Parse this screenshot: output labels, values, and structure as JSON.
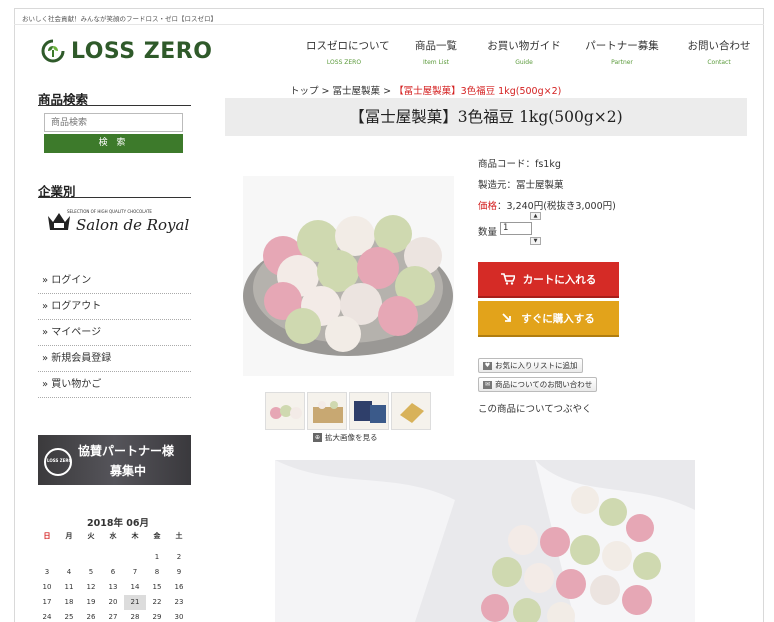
{
  "header": {
    "tagline": "おいしく社会貢献！みんなが笑顔のフードロス・ゼロ【ロスゼロ】",
    "logo_text": "LOSS ZERO",
    "nav": [
      {
        "ja": "ロスゼロについて",
        "en": "LOSS ZERO"
      },
      {
        "ja": "商品一覧",
        "en": "Item List"
      },
      {
        "ja": "お買い物ガイド",
        "en": "Guide"
      },
      {
        "ja": "パートナー募集",
        "en": "Partner"
      },
      {
        "ja": "お問い合わせ",
        "en": "Contact"
      }
    ]
  },
  "sidebar": {
    "search_title": "商品検索",
    "search_placeholder": "商品検索",
    "search_button": "検 索",
    "company_title": "企業別",
    "salon_sub": "SELECTION OF HIGH QUALITY CHOCOLATE",
    "salon_name": "Salon de Royal",
    "menu": [
      "» ログイン",
      "» ログアウト",
      "» マイページ",
      "» 新規会員登録",
      "» 買い物かご"
    ],
    "banner_line1": "協賛パートナー様",
    "banner_line2": "募集中",
    "banner_logo": "LOSS ZERO",
    "calendar": {
      "title": "2018年 06月",
      "weekdays": [
        "日",
        "月",
        "火",
        "水",
        "木",
        "金",
        "土"
      ],
      "rows": [
        [
          "",
          "",
          "",
          "",
          "",
          "1",
          "2"
        ],
        [
          "3",
          "4",
          "5",
          "6",
          "7",
          "8",
          "9"
        ],
        [
          "10",
          "11",
          "12",
          "13",
          "14",
          "15",
          "16"
        ],
        [
          "17",
          "18",
          "19",
          "20",
          "21",
          "22",
          "23"
        ],
        [
          "24",
          "25",
          "26",
          "27",
          "28",
          "29",
          "30"
        ]
      ],
      "today": "21"
    }
  },
  "product": {
    "breadcrumb_home": "トップ",
    "breadcrumb_sep": ">",
    "breadcrumb_cat": "冨士屋製菓",
    "breadcrumb_current": "【冨士屋製菓】3色福豆 1kg(500g×2)",
    "title": "【冨士屋製菓】3色福豆 1kg(500g×2)",
    "code": "商品コード：fs1kg",
    "maker": "製造元：冨士屋製菓",
    "price_label": "価格",
    "price_value": "：3,240円(税抜き3,000円)",
    "qty_label": "数量",
    "qty_value": "1",
    "cart_button": "カートに入れる",
    "buy_button": "すぐに購入する",
    "favorite_button": "お気に入りリストに追加",
    "inquiry_button": "商品についてのお問い合わせ",
    "tweet_text": "この商品についてつぶやく",
    "zoom_link": "拡大画像を見る"
  },
  "colors": {
    "brand_green": "#3d7a2b",
    "cart_red": "#d52b26",
    "buy_orange": "#e2a31b",
    "accent_red": "#d42020"
  }
}
